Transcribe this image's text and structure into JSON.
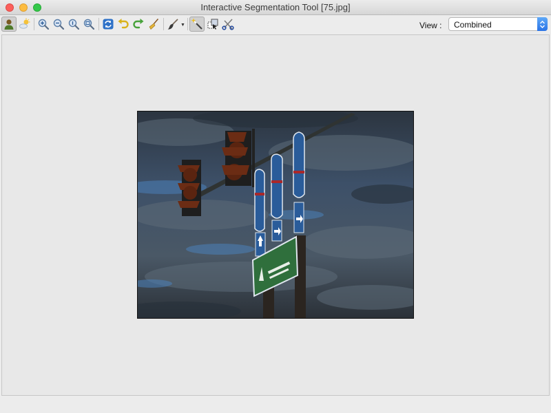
{
  "window": {
    "title": "Interactive Segmentation Tool [75.jpg]"
  },
  "toolbar": {
    "tools": [
      {
        "name": "foreground-tool",
        "icon": "person-icon",
        "pressed": true
      },
      {
        "name": "background-tool",
        "icon": "sun-cloud-icon"
      },
      {
        "name": "zoom-in",
        "icon": "zoom-in-icon"
      },
      {
        "name": "zoom-out",
        "icon": "zoom-out-icon"
      },
      {
        "name": "zoom-actual",
        "icon": "zoom-actual-icon"
      },
      {
        "name": "zoom-fit",
        "icon": "zoom-fit-icon"
      },
      {
        "name": "refresh",
        "icon": "refresh-icon"
      },
      {
        "name": "undo",
        "icon": "undo-icon"
      },
      {
        "name": "redo",
        "icon": "redo-icon"
      },
      {
        "name": "clear",
        "icon": "broom-icon"
      },
      {
        "name": "brush",
        "icon": "brush-icon",
        "has_dropdown": true
      },
      {
        "name": "magic-wand",
        "icon": "magic-wand-icon",
        "pressed": true
      },
      {
        "name": "select-region",
        "icon": "select-region-icon"
      },
      {
        "name": "cut",
        "icon": "scissors-icon"
      }
    ],
    "view_label": "View :",
    "view_selected": "Combined"
  },
  "canvas": {
    "image_file": "75.jpg",
    "image_icon": "road-signs-photo"
  },
  "colors": {
    "accent": "#3d7fea",
    "sign_green": "#2f6f3c",
    "sign_blue": "#2a5c9a",
    "signal_orange": "#8a3a18"
  }
}
